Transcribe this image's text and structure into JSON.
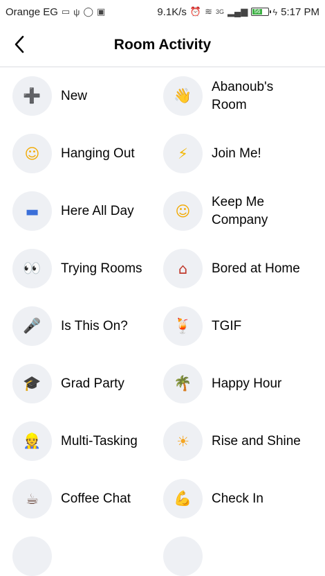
{
  "status_bar": {
    "carrier": "Orange EG",
    "speed": "9.1K/s",
    "network": "3G",
    "battery": "56",
    "time": "5:17 PM"
  },
  "header": {
    "title": "Room Activity",
    "back_icon": "chevron-left-icon"
  },
  "activities": [
    {
      "label": "New",
      "icon": "plus-icon",
      "glyph": "➕",
      "color": "#8a8f98"
    },
    {
      "label": "Abanoub's\nRoom",
      "icon": "waving-hand-icon",
      "glyph": "👋",
      "color": "#f4b400"
    },
    {
      "label": "Hanging Out",
      "icon": "smiley-icon",
      "glyph": "☺",
      "color": "#f2a900"
    },
    {
      "label": "Join Me!",
      "icon": "lightning-icon",
      "glyph": "⚡",
      "color": "#f2b705"
    },
    {
      "label": "Here All Day",
      "icon": "couch-icon",
      "glyph": "▬",
      "color": "#3b6fd9"
    },
    {
      "label": "Keep Me\nCompany",
      "icon": "hugging-face-icon",
      "glyph": "☺",
      "color": "#f2a900"
    },
    {
      "label": "Trying Rooms",
      "icon": "eyes-icon",
      "glyph": "👀",
      "color": "#333333"
    },
    {
      "label": "Bored at Home",
      "icon": "house-icon",
      "glyph": "⌂",
      "color": "#c0392b"
    },
    {
      "label": "Is This On?",
      "icon": "microphone-icon",
      "glyph": "🎤",
      "color": "#444444"
    },
    {
      "label": "TGIF",
      "icon": "tropical-drink-icon",
      "glyph": "🍹",
      "color": "#e67e22"
    },
    {
      "label": "Grad Party",
      "icon": "graduation-cap-icon",
      "glyph": "🎓",
      "color": "#222222"
    },
    {
      "label": "Happy Hour",
      "icon": "palm-tree-icon",
      "glyph": "🌴",
      "color": "#2e8b57"
    },
    {
      "label": "Multi-Tasking",
      "icon": "office-worker-icon",
      "glyph": "👷",
      "color": "#5b7bb5"
    },
    {
      "label": "Rise and Shine",
      "icon": "sun-icon",
      "glyph": "☀",
      "color": "#f5a623"
    },
    {
      "label": "Coffee Chat",
      "icon": "coffee-icon",
      "glyph": "☕",
      "color": "#6d4c41"
    },
    {
      "label": "Check In",
      "icon": "flexed-biceps-icon",
      "glyph": "💪",
      "color": "#f2a900"
    },
    {
      "label": "",
      "icon": "partial-icon",
      "glyph": "",
      "color": "#999999"
    },
    {
      "label": "",
      "icon": "partial-icon",
      "glyph": "",
      "color": "#999999"
    }
  ]
}
